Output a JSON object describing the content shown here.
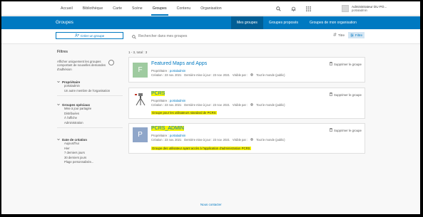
{
  "nav": {
    "items": [
      "Accueil",
      "Bibliothèque",
      "Carte",
      "Scène",
      "Groupes",
      "Contenu",
      "Organisation"
    ],
    "active_index": 4,
    "icons": [
      "search-icon",
      "bell-icon",
      "apps-grid-icon"
    ]
  },
  "user": {
    "name": "Administrateur DU PO...",
    "login": "portaladmin"
  },
  "header": {
    "title": "Groupes",
    "tabs": [
      "Mes groupes",
      "Groupes proposés",
      "Groupes de mon organisation"
    ],
    "active_tab": 0
  },
  "toolbar": {
    "create_label": "Créer un groupe",
    "search_placeholder": "Rechercher dans mes groupes",
    "sort_label": "Titre",
    "filter_label": "Filtre"
  },
  "filters": {
    "title": "Filtres",
    "only_owned": "Afficher uniquement les groupes comportant de nouvelles demandes d'adhésion",
    "groups": [
      {
        "title": "Propriétaire",
        "items": [
          "portaladmin",
          "Un autre membre de l'organisation"
        ]
      },
      {
        "title": "Groupes spéciaux",
        "items": [
          "Mise à jour partagée",
          "Distribuées",
          "À l'affiche",
          "Administration"
        ]
      },
      {
        "title": "Date de création",
        "items": [
          "Aujourd'hui",
          "Hier",
          "7 derniers jours",
          "30 derniers jours",
          "Plage personnalisée..."
        ]
      }
    ]
  },
  "results": {
    "count": "1 - 3, total : 3",
    "cards": [
      {
        "title": "Featured Maps and Apps",
        "thumb_letter": "F",
        "thumb_color": "#9fcba0",
        "owner_label": "Propriétaire :",
        "owner": "portaladmin",
        "created": "Création : 23 nov. 2021",
        "updated": "Dernière mise à jour : 23 nov. 2021",
        "visibility": "Visible par :",
        "visibility_value": "Tout le monde (public)",
        "description": "",
        "delete_label": "Supprimer le groupe"
      },
      {
        "title": "PCRS",
        "thumb_letter": "",
        "thumb_color": "#ffffff",
        "owner_label": "Propriétaire :",
        "owner": "portaladmin",
        "created": "Création : 23 nov. 2021",
        "updated": "Dernière mise à jour : 23 nov. 2021",
        "visibility": "Visible par :",
        "visibility_value": "Tout le monde (public)",
        "description": "Groupe pour les utilisateurs standard de PCRS",
        "delete_label": "Supprimer le groupe"
      },
      {
        "title": "PCRS_ADMIN",
        "thumb_letter": "P",
        "thumb_color": "#8fa6c9",
        "owner_label": "Propriétaire :",
        "owner": "portaladmin",
        "created": "Création : 23 nov. 2021",
        "updated": "Dernière mise à jour : 23 nov. 2021",
        "visibility": "Visible par :",
        "visibility_value": "Tout le monde (public)",
        "description": "Groupe des utilisateur ayant accès à l'application d'administration PCRS",
        "delete_label": "Supprimer le groupe"
      }
    ]
  },
  "footer": {
    "contact_label": "Nous contacter"
  },
  "colors": {
    "brand": "#0079c1",
    "highlight": "#f6f400"
  }
}
